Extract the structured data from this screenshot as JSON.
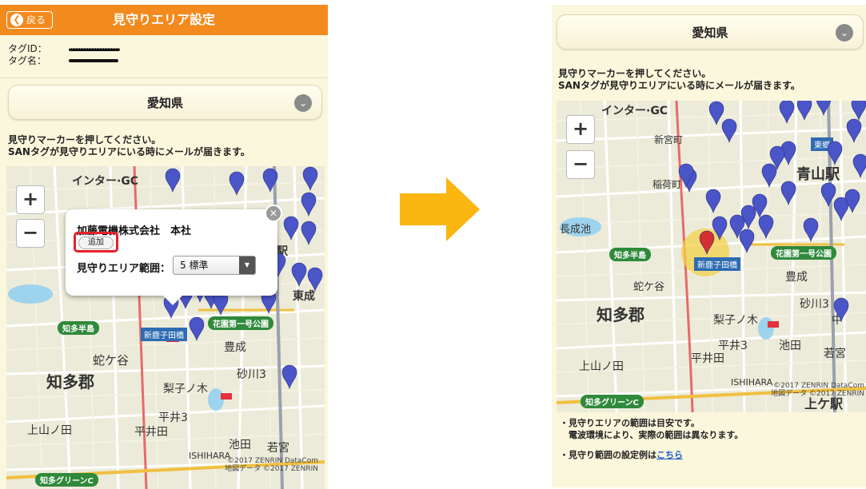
{
  "left_screen": {
    "header": {
      "back_label": "戻る",
      "title": "見守りエリア設定"
    },
    "tag_info": {
      "id_label": "タグID：",
      "name_label": "タグ名："
    },
    "prefecture": "愛知県",
    "instructions": [
      "見守りマーカーを押してください。",
      "SANタグが見守りエリアにいる時にメールが届きます。"
    ],
    "popup": {
      "place_name": "加藤電機株式会社　本社",
      "add_label": "追加",
      "range_label": "見守りエリア範囲：",
      "range_value": "5 標準"
    },
    "map": {
      "labels": [
        "インター·GC",
        "知多半島",
        "蛇ケ谷",
        "知多郡",
        "新鹿子田橋",
        "花園第一号公園",
        "梨子ノ木",
        "豊成",
        "砂川3",
        "平井3",
        "池田",
        "若宮",
        "上山ノ田",
        "平井田",
        "知多グリーンC",
        "東成",
        "駅",
        "ISHIHARA"
      ],
      "copyright": [
        "©2017 ZENRIN DataCom",
        "地図データ ©2017 ZENRIN"
      ]
    }
  },
  "right_screen": {
    "prefecture": "愛知県",
    "instructions": [
      "見守りマーカーを押してください。",
      "SANタグが見守りエリアにいる時にメールが届きます。"
    ],
    "map": {
      "labels": [
        "インター·GC",
        "新宮町",
        "稲荷町",
        "青山駅",
        "知多半島",
        "蛇ケ谷",
        "知多郡",
        "新鹿子田橋",
        "花園第一号公園",
        "豊成",
        "砂川3",
        "中",
        "梨子ノ木",
        "平井3",
        "池田",
        "若宮",
        "上山ノ田",
        "平井田",
        "ISHIHARA",
        "知多グリーンC",
        "上ケ駅",
        "東郷",
        "長成池"
      ],
      "copyright": [
        "©2017 ZENRIN DataCom",
        "地図データ ©2017 ZENRIN"
      ]
    },
    "notes": {
      "line1": "・見守りエリアの範囲は目安です。",
      "line2": "電波環境により、実際の範囲は異なります。",
      "line3_prefix": "・見守り範囲の設定例は",
      "line3_link": "こちら"
    }
  },
  "colors": {
    "header": "#f28a1e",
    "panel_bg": "#fbf7dc",
    "arrow": "#fbb612",
    "pin": "#4a55c8",
    "selected_pin": "#d53030",
    "highlight": "#e8202a"
  }
}
